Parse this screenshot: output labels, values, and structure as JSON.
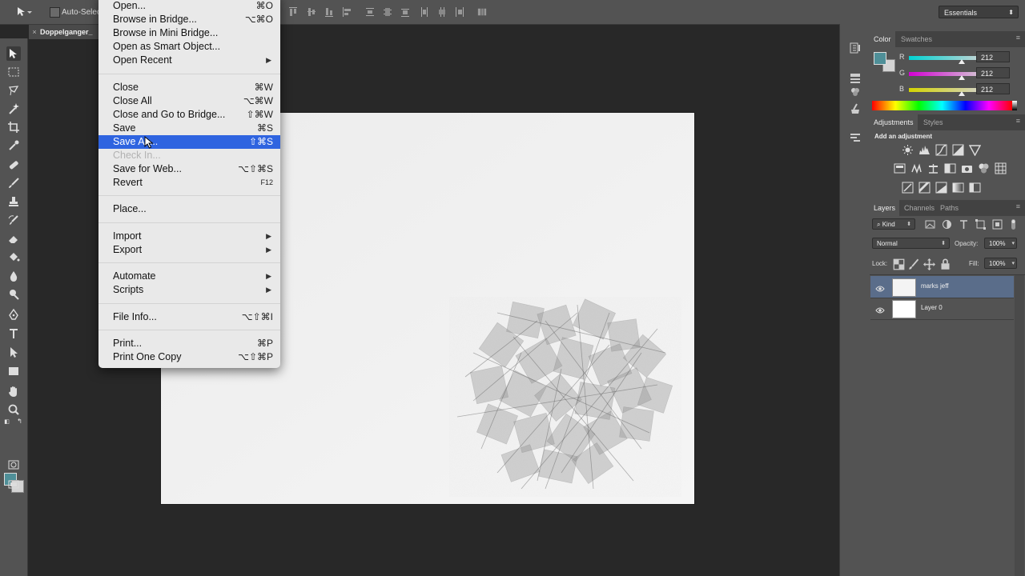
{
  "options_bar": {
    "auto_select_label": "Auto-Select",
    "workspace_label": "Essentials"
  },
  "document_tab": {
    "close_glyph": "×",
    "title": "Doppelganger_"
  },
  "file_menu": {
    "items": [
      {
        "label": "Open...",
        "shortcut": "⌘O"
      },
      {
        "label": "Browse in Bridge...",
        "shortcut": "⌥⌘O"
      },
      {
        "label": "Browse in Mini Bridge...",
        "shortcut": ""
      },
      {
        "label": "Open as Smart Object...",
        "shortcut": ""
      },
      {
        "label": "Open Recent",
        "shortcut": "",
        "submenu": true
      },
      {
        "label": "Close",
        "shortcut": "⌘W"
      },
      {
        "label": "Close All",
        "shortcut": "⌥⌘W"
      },
      {
        "label": "Close and Go to Bridge...",
        "shortcut": "⇧⌘W"
      },
      {
        "label": "Save",
        "shortcut": "⌘S"
      },
      {
        "label": "Save As...",
        "shortcut": "⇧⌘S",
        "highlighted": true
      },
      {
        "label": "Check In...",
        "shortcut": "",
        "disabled": true
      },
      {
        "label": "Save for Web...",
        "shortcut": "⌥⇧⌘S"
      },
      {
        "label": "Revert",
        "shortcut": "F12"
      },
      {
        "label": "Place...",
        "shortcut": ""
      },
      {
        "label": "Import",
        "shortcut": "",
        "submenu": true
      },
      {
        "label": "Export",
        "shortcut": "",
        "submenu": true
      },
      {
        "label": "Automate",
        "shortcut": "",
        "submenu": true
      },
      {
        "label": "Scripts",
        "shortcut": "",
        "submenu": true
      },
      {
        "label": "File Info...",
        "shortcut": "⌥⇧⌘I"
      },
      {
        "label": "Print...",
        "shortcut": "⌘P"
      },
      {
        "label": "Print One Copy",
        "shortcut": "⌥⇧⌘P"
      }
    ],
    "submenu_glyph": "▶"
  },
  "color_panel": {
    "tabs": [
      "Color",
      "Swatches"
    ],
    "foreground": "#4f8f98",
    "background": "#d4d4d4",
    "channels": [
      {
        "name": "R",
        "value": "212"
      },
      {
        "name": "G",
        "value": "212"
      },
      {
        "name": "B",
        "value": "212"
      }
    ]
  },
  "adjustments_panel": {
    "tabs": [
      "Adjustments",
      "Styles"
    ],
    "heading": "Add an adjustment",
    "icons": [
      "brightness-contrast-icon",
      "levels-icon",
      "curves-icon",
      "exposure-icon",
      "gradient-triangle-icon",
      "vibrance-icon",
      "hue-saturation-icon",
      "color-balance-icon",
      "black-white-icon",
      "photo-filter-icon",
      "channel-mixer-icon",
      "color-lookup-icon",
      "invert-icon",
      "posterize-icon",
      "threshold-icon",
      "gradient-map-icon",
      "selective-color-icon"
    ]
  },
  "layers_panel": {
    "tabs": [
      "Layers",
      "Channels",
      "Paths"
    ],
    "kind_label": "Kind",
    "blend_mode": "Normal",
    "opacity_label": "Opacity:",
    "opacity_value": "100%",
    "lock_label": "Lock:",
    "fill_label": "Fill:",
    "fill_value": "100%",
    "layers": [
      {
        "name": "marks jeff",
        "selected": true
      },
      {
        "name": "Layer 0",
        "selected": false
      }
    ]
  },
  "colors": {
    "menu_highlight": "#2f64e0",
    "selected_layer": "#5a6d8a"
  }
}
